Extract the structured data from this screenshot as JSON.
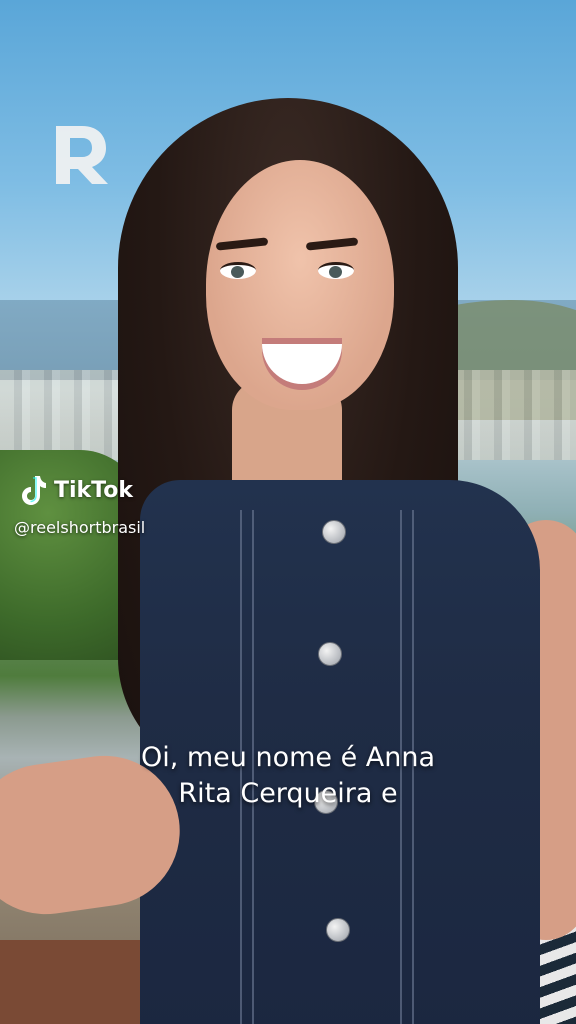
{
  "overlay": {
    "logo_icon": "reelshort-r-logo",
    "platform_name": "TikTok",
    "handle": "@reelshortbrasil"
  },
  "subtitle": {
    "line1": "Oi, meu nome é Anna",
    "line2": "Rita Cerqueira e"
  },
  "colors": {
    "caption_text": "#ffffff",
    "dress_denim": "#22324e",
    "sky": "#7fbde4"
  }
}
